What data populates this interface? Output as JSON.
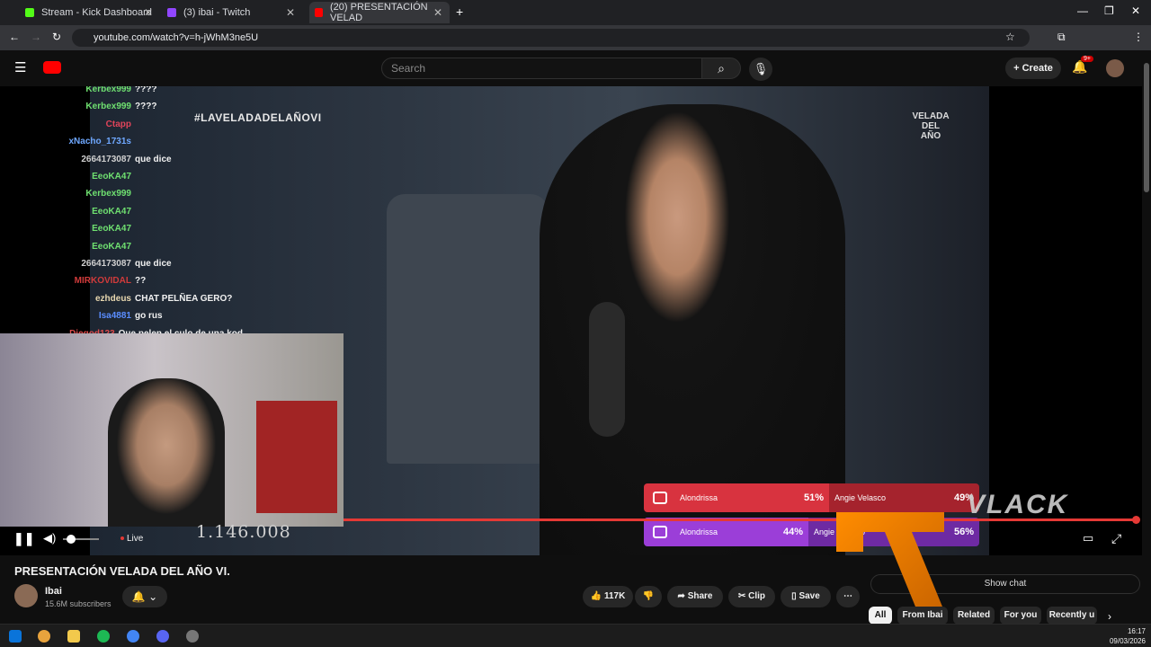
{
  "browser": {
    "tabs": [
      {
        "label": "Stream - Kick Dashboard",
        "color": "#53fc18"
      },
      {
        "label": "(3) ibai - Twitch",
        "color": "#9146ff"
      },
      {
        "label": "(20) PRESENTACIÓN VELAD",
        "color": "#ff0000"
      }
    ],
    "url": "youtube.com/watch?v=h-jWhM3ne5U"
  },
  "youtube": {
    "search_placeholder": "Search",
    "create_label": "Create",
    "notif_count": "9+"
  },
  "player": {
    "hashtag": "#LAVELADADELAÑOVI",
    "velada_logo": "VELADA DEL AÑO",
    "counter": "1.146.008",
    "live_label": "Live",
    "chat": [
      {
        "user": "Kerbex999",
        "text": "????",
        "color": "#6fe070"
      },
      {
        "user": "Kerbex999",
        "text": "????",
        "color": "#6fe070"
      },
      {
        "user": "Ctapp",
        "text": "",
        "color": "#e0445a"
      },
      {
        "user": "xNacho_1731s",
        "text": "",
        "color": "#6fa8ff"
      },
      {
        "user": "2664173087",
        "text": "que dice",
        "color": "#d0d0d0"
      },
      {
        "user": "EeoKA47",
        "text": "",
        "color": "#6fe070"
      },
      {
        "user": "Kerbex999",
        "text": "",
        "color": "#6fe070"
      },
      {
        "user": "EeoKA47",
        "text": "",
        "color": "#6fe070"
      },
      {
        "user": "EeoKA47",
        "text": "",
        "color": "#6fe070"
      },
      {
        "user": "EeoKA47",
        "text": "",
        "color": "#6fe070"
      },
      {
        "user": "2664173087",
        "text": "que dice",
        "color": "#d0d0d0"
      },
      {
        "user": "MIRKOVIDAL",
        "text": "??",
        "color": "#d13b3b"
      },
      {
        "user": "ezhdeus",
        "text": "CHAT PELÑEA GERO?",
        "color": "#e8d8b0"
      },
      {
        "user": "Isa4881",
        "text": "go rus",
        "color": "#5a8dff"
      },
      {
        "user": "Diegod123",
        "text": "Que pelen el culo de una kod",
        "color": "#e04b4b"
      }
    ],
    "polls": [
      {
        "left_name": "Alondrissa",
        "left_pct": "51%",
        "right_name": "Angie Velasco",
        "right_pct": "49%",
        "left_color": "#d8333f",
        "right_color": "#a5232d"
      },
      {
        "left_name": "Alondrissa",
        "left_pct": "44%",
        "right_name": "Angie Velasco",
        "right_pct": "56%",
        "left_color": "#9b3ed8",
        "right_color": "#6e2aa3"
      }
    ],
    "watermark": "VLACK"
  },
  "video": {
    "title": "PRESENTACIÓN VELADA DEL AÑO VI.",
    "channel": "Ibai",
    "subscribers": "15.6M subscribers",
    "likes": "117K",
    "share_label": "Share",
    "clip_label": "Clip",
    "save_label": "Save",
    "show_chat": "Show chat"
  },
  "chips": [
    "All",
    "From Ibai",
    "Related",
    "For you",
    "Recently u"
  ],
  "taskbar": {
    "time": "16:17",
    "date": "09/03/2026"
  }
}
